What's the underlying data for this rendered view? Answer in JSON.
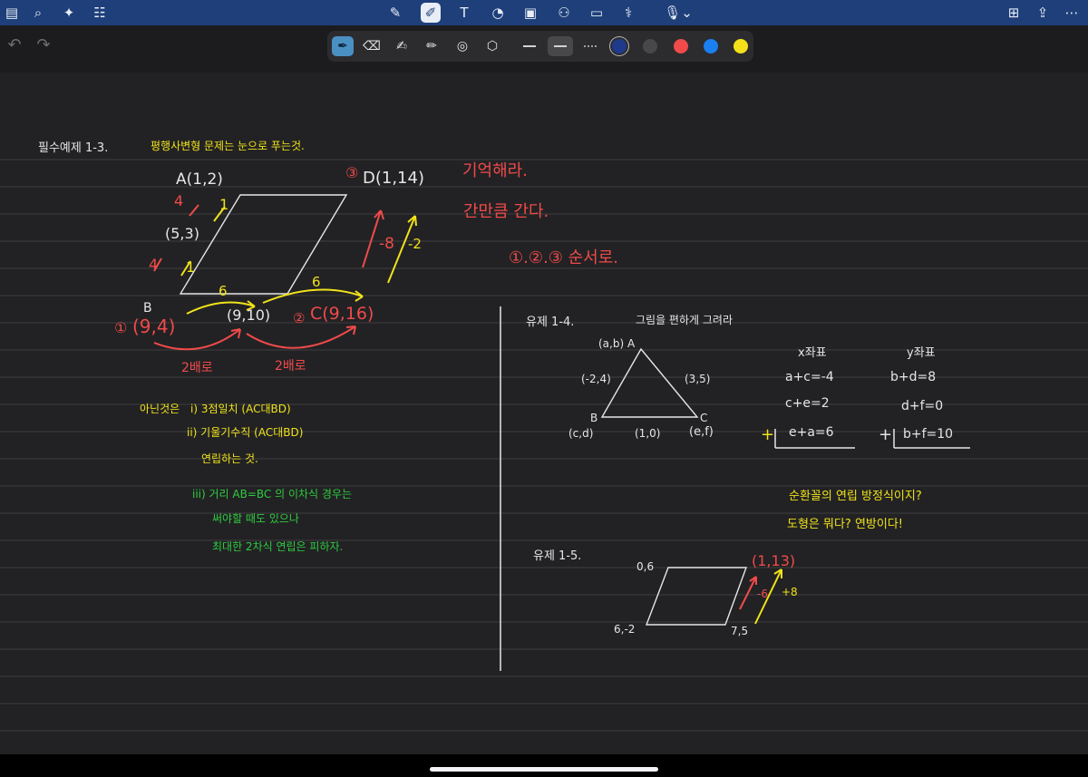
{
  "colors": {
    "topbar": "#1e3f7a",
    "white_ink": "#e6e6e6",
    "yellow_ink": "#f0e21a",
    "red_ink": "#f04a4a",
    "green_ink": "#2ecc40",
    "line": "#3d3d40"
  },
  "toolbar_icons": [
    "sidebar-icon",
    "search-icon",
    "sparkle-icon",
    "document-icon",
    "lasso-icon",
    "pen-icon",
    "textbox-icon",
    "shapes-icon",
    "image-icon",
    "elements-icon",
    "sticky-note-icon",
    "sticker-icon",
    "microphone-icon",
    "add-page-icon",
    "share-icon",
    "more-icon"
  ],
  "tools": [
    "pen-tool",
    "eraser-tool",
    "highlighter-tool",
    "pencil-tool",
    "shape-tool",
    "lasso-tool"
  ],
  "swatches": [
    "#1f3a8a",
    "#48484a",
    "#f04a4a",
    "#1a7ff0",
    "#f5e11a"
  ],
  "note": {
    "title": "필수예제 1-3.",
    "subtitle": "평행사변형 문제는 눈으로 푸는것.",
    "pA": "A(1,2)",
    "pD": "D(1,14)",
    "pD_circle": "③",
    "remember": "기억해라.",
    "same_amount": "간만큼 간다.",
    "order": "①.②.③ 순서로.",
    "left_4a": "4",
    "left_1a": "1",
    "mid_point": "(5,3)",
    "left_4b": "4",
    "left_1b": "1",
    "pB": "B",
    "pB_val": "(9,4)",
    "pB_circle": "①",
    "mid_bottom": "(9,10)",
    "pC": "C(9,16)",
    "pC_circle": "②",
    "six1": "6",
    "six2": "6",
    "twice1": "2배로",
    "twice2": "2배로",
    "minus8": "-8",
    "minus2": "-2",
    "cond_label": "아닌것은",
    "cond1": "i) 3점일치 (AC대BD)",
    "cond2": "ii) 기울기수직 (AC대BD)",
    "cond3": "연립하는 것.",
    "cond4": "iii) 거리 AB=BC 의 이차식 경우는",
    "cond5": "써야할 때도 있으나",
    "cond6": "최대한 2차식 연립은 피하자.",
    "ex14_title": "유제 1-4.",
    "ex14_sub": "그림을 편하게 그려라",
    "tri_top": "(a,b) A",
    "tri_left": "(-2,4)",
    "tri_right": "(3,5)",
    "tri_B": "B",
    "tri_C": "C",
    "tri_cd": "(c,d)",
    "tri_10": "(1,0)",
    "tri_ef": "(e,f)",
    "x_head": "x좌표",
    "y_head": "y좌표",
    "x1": "a+c=-4",
    "x2": "c+e=2",
    "x3": "e+a=6",
    "y1": "b+d=8",
    "y2": "d+f=0",
    "y3": "b+f=10",
    "plus": "+",
    "q1": "순환꼴의 연립 방정식이지?",
    "q2": "도형은 뭐다? 연방이다!",
    "ex15_title": "유제 1-5.",
    "p06": "0,6",
    "p113": "(1,13)",
    "p62": "6,-2",
    "p75": "7,5",
    "m6": "-6",
    "p8": "+8"
  }
}
